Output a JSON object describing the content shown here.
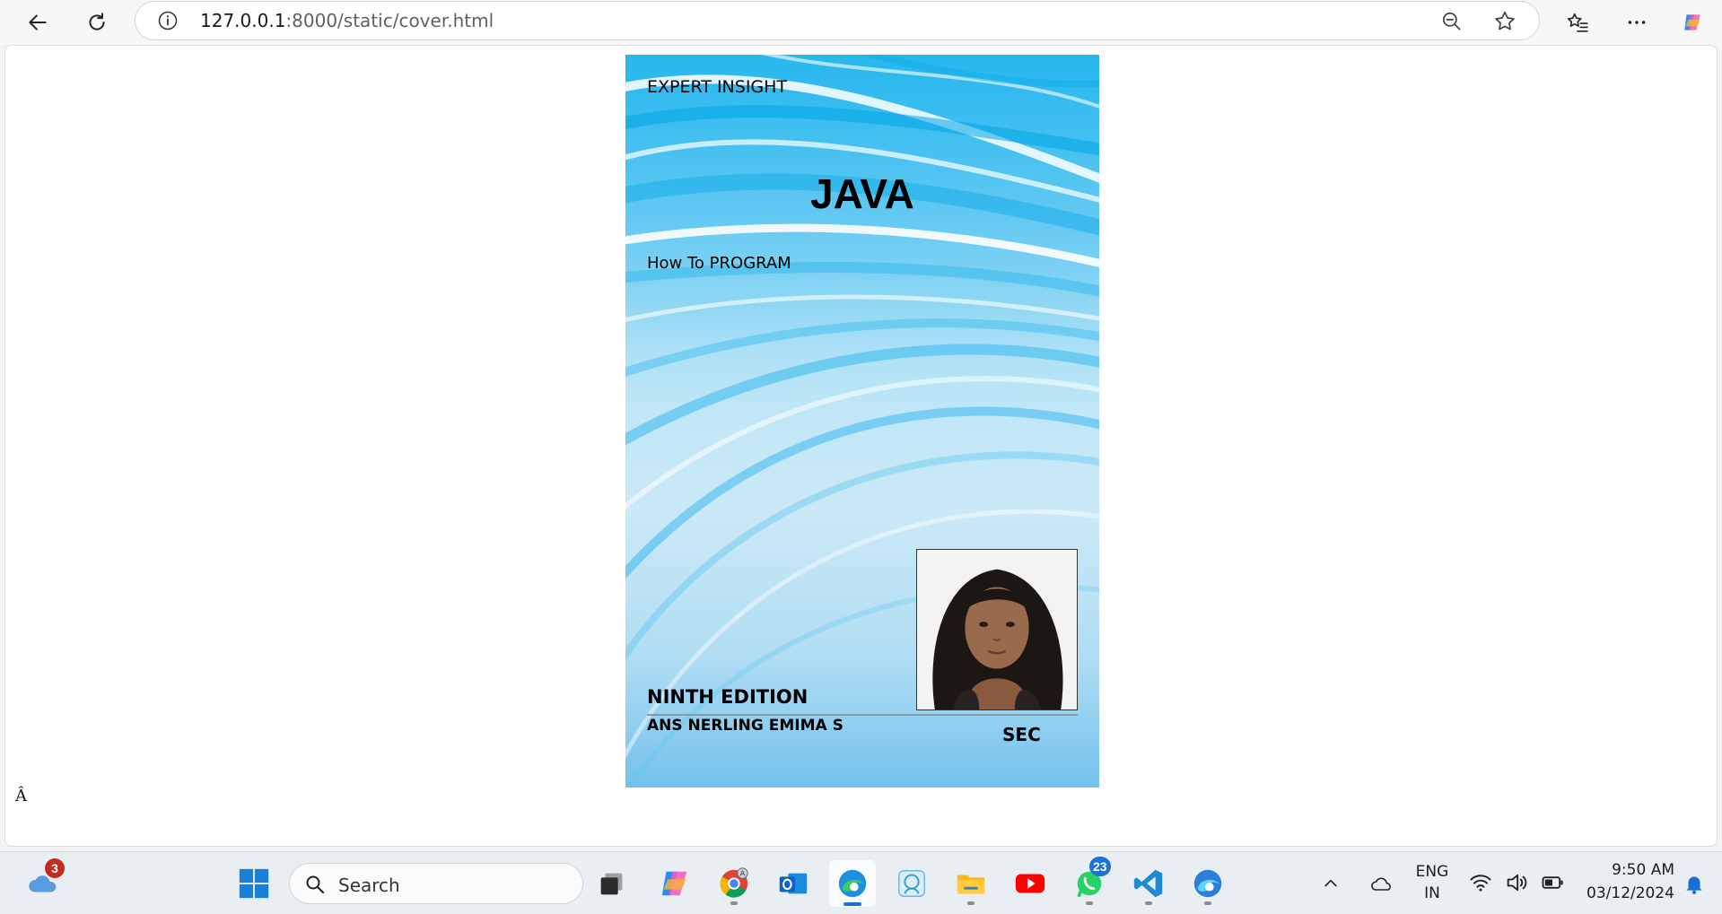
{
  "browser": {
    "url_host": "127.0.0.1",
    "url_path": ":8000/static/cover.html",
    "icons": [
      "back-icon",
      "refresh-icon",
      "site-info-icon",
      "zoom-out-icon",
      "favorite-star-icon",
      "favorites-list-icon",
      "more-icon",
      "copilot-icon"
    ]
  },
  "page": {
    "stray_text": "Â"
  },
  "cover": {
    "series": "EXPERT INSIGHT",
    "title": "JAVA",
    "subtitle": "How To PROGRAM",
    "edition": "NINTH EDITION",
    "author": "ANS NERLING EMIMA S",
    "publisher": "SEC",
    "colors": {
      "primary_blue": "#00aeef",
      "light_blue": "#cbe9f7"
    }
  },
  "taskbar": {
    "weather_badge": "3",
    "search_placeholder": "Search",
    "whatsapp_badge": "23",
    "apps": [
      "widgets-weather-icon",
      "start-icon",
      "task-view-icon",
      "copilot-icon",
      "chrome-icon",
      "outlook-icon",
      "edge-icon",
      "app-icon",
      "file-explorer-icon",
      "youtube-icon",
      "whatsapp-icon",
      "vscode-icon",
      "edge-beta-icon"
    ],
    "language_line1": "ENG",
    "language_line2": "IN",
    "time": "9:50 AM",
    "date": "03/12/2024"
  }
}
